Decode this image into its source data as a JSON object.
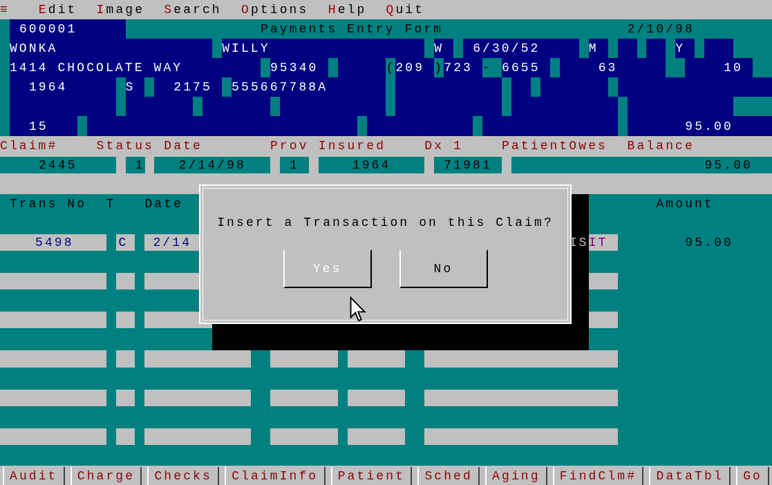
{
  "menu": [
    {
      "label": "≡"
    },
    {
      "label": "Edit"
    },
    {
      "label": "Image"
    },
    {
      "label": "Search"
    },
    {
      "label": "Options"
    },
    {
      "label": "Help"
    },
    {
      "label": "Quit"
    }
  ],
  "patient_panel": {
    "fields": [
      {
        "text": "600001"
      },
      {
        "text": "Payments Entry Form"
      },
      {
        "text": "2/10/98"
      },
      {
        "text": "WONKA"
      },
      {
        "text": "WILLY"
      },
      {
        "text": "W"
      },
      {
        "text": "6/30/52"
      },
      {
        "text": "M"
      },
      {
        "text": "Y"
      },
      {
        "text": "1414 CHOCOLATE WAY"
      },
      {
        "text": "95340"
      },
      {
        "text": "("
      },
      {
        "text": "209"
      },
      {
        "text": ")"
      },
      {
        "text": "723"
      },
      {
        "text": "-"
      },
      {
        "text": "6655"
      },
      {
        "text": "63"
      },
      {
        "text": "10"
      },
      {
        "text": "1964"
      },
      {
        "text": "S"
      },
      {
        "text": "2175"
      },
      {
        "text": "555667788A"
      },
      {
        "text": "15"
      },
      {
        "text": "95.00"
      }
    ]
  },
  "claim": {
    "labels": [
      "Claim#",
      "Status",
      "Date",
      "Prov",
      "Insured",
      "Dx 1",
      "PatientOwes",
      "Balance"
    ],
    "values": [
      "2445",
      "1",
      "2/14/98",
      "1",
      "1964",
      "71981",
      "95.00"
    ]
  },
  "transactions": {
    "columns": [
      "Trans No",
      "T",
      "Date",
      "Amount"
    ],
    "rows": [
      {
        "cells": [
          "5498",
          "C",
          "2/14",
          "IS",
          "IT",
          "95.00"
        ]
      }
    ]
  },
  "dialog": {
    "message": "Insert a Transaction on this Claim?",
    "buttons": [
      {
        "label": "Yes",
        "focused": true
      },
      {
        "label": "No",
        "focused": false
      }
    ]
  },
  "function_keys": [
    "Audit",
    "Charge",
    "Checks",
    "ClaimInfo",
    "Patient",
    "Sched",
    "Aging",
    "FindClm#",
    "DataTbl",
    "Go"
  ]
}
